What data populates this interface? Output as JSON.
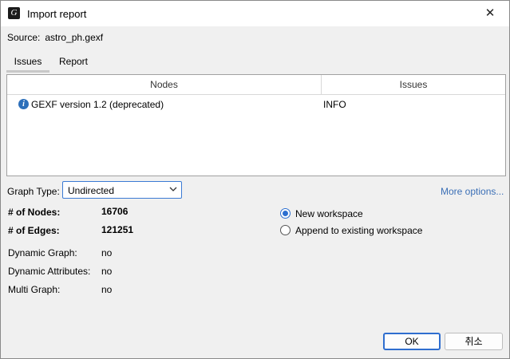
{
  "window": {
    "title": "Import report",
    "close_glyph": "✕",
    "app_icon": "gephi-logo-icon"
  },
  "source": {
    "label": "Source:",
    "value": "astro_ph.gexf"
  },
  "tabs": [
    {
      "label": "Issues",
      "active": true
    },
    {
      "label": "Report",
      "active": false
    }
  ],
  "issues_table": {
    "columns": [
      "Nodes",
      "Issues"
    ],
    "rows": [
      {
        "icon": "info-icon",
        "description": "GEXF version 1.2 (deprecated)",
        "level": "INFO"
      }
    ]
  },
  "graph_type": {
    "label": "Graph Type:",
    "selected": "Undirected"
  },
  "more_options": "More options...",
  "stats": {
    "nodes_label": "# of Nodes:",
    "nodes_value": "16706",
    "edges_label": "# of Edges:",
    "edges_value": "121251",
    "dynamic_graph_label": "Dynamic Graph:",
    "dynamic_graph_value": "no",
    "dynamic_attributes_label": "Dynamic Attributes:",
    "dynamic_attributes_value": "no",
    "multi_graph_label": "Multi Graph:",
    "multi_graph_value": "no"
  },
  "workspace": {
    "options": [
      {
        "label": "New workspace",
        "checked": true
      },
      {
        "label": "Append to existing workspace",
        "checked": false
      }
    ]
  },
  "buttons": {
    "ok": "OK",
    "cancel": "취소"
  },
  "colors": {
    "accent": "#2c6fd0",
    "link": "#3b6fb6",
    "info_icon": "#2c6fba"
  }
}
